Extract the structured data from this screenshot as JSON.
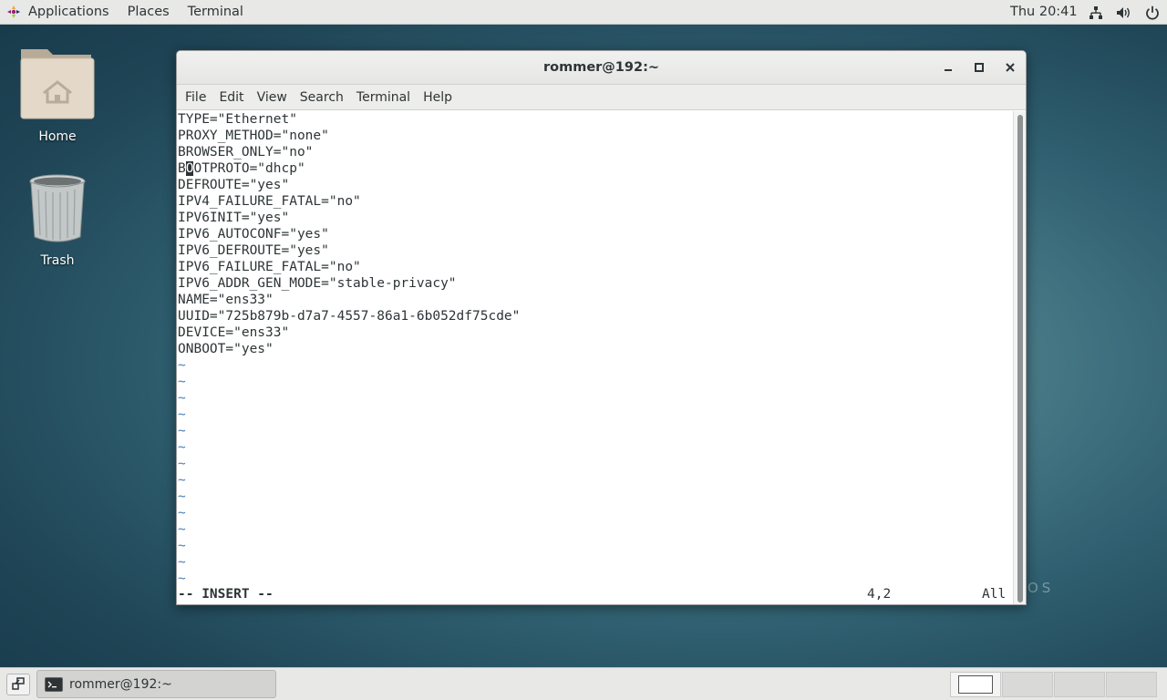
{
  "topbar": {
    "applications": "Applications",
    "places": "Places",
    "terminal": "Terminal",
    "clock": "Thu 20:41"
  },
  "desktop": {
    "home_label": "Home",
    "trash_label": "Trash",
    "watermark": "OS"
  },
  "window": {
    "title": "rommer@192:~",
    "menu": [
      "File",
      "Edit",
      "View",
      "Search",
      "Terminal",
      "Help"
    ]
  },
  "editor": {
    "lines": [
      "TYPE=\"Ethernet\"",
      "PROXY_METHOD=\"none\"",
      "BROWSER_ONLY=\"no\"",
      "BOOTPROTO=\"dhcp\"",
      "DEFROUTE=\"yes\"",
      "IPV4_FAILURE_FATAL=\"no\"",
      "IPV6INIT=\"yes\"",
      "IPV6_AUTOCONF=\"yes\"",
      "IPV6_DEFROUTE=\"yes\"",
      "IPV6_FAILURE_FATAL=\"no\"",
      "IPV6_ADDR_GEN_MODE=\"stable-privacy\"",
      "NAME=\"ens33\"",
      "UUID=\"725b879b-d7a7-4557-86a1-6b052df75cde\"",
      "DEVICE=\"ens33\"",
      "ONBOOT=\"yes\""
    ],
    "empty_line_marker": "~",
    "empty_line_count": 14,
    "cursor": {
      "line": 4,
      "column": 2
    },
    "status_mode": "-- INSERT --",
    "status_position": "4,2",
    "status_percent": "All"
  },
  "taskbar": {
    "task_label": "rommer@192:~"
  },
  "colors": {
    "tilde": "#4a7fb5",
    "text": "#2e3436"
  }
}
